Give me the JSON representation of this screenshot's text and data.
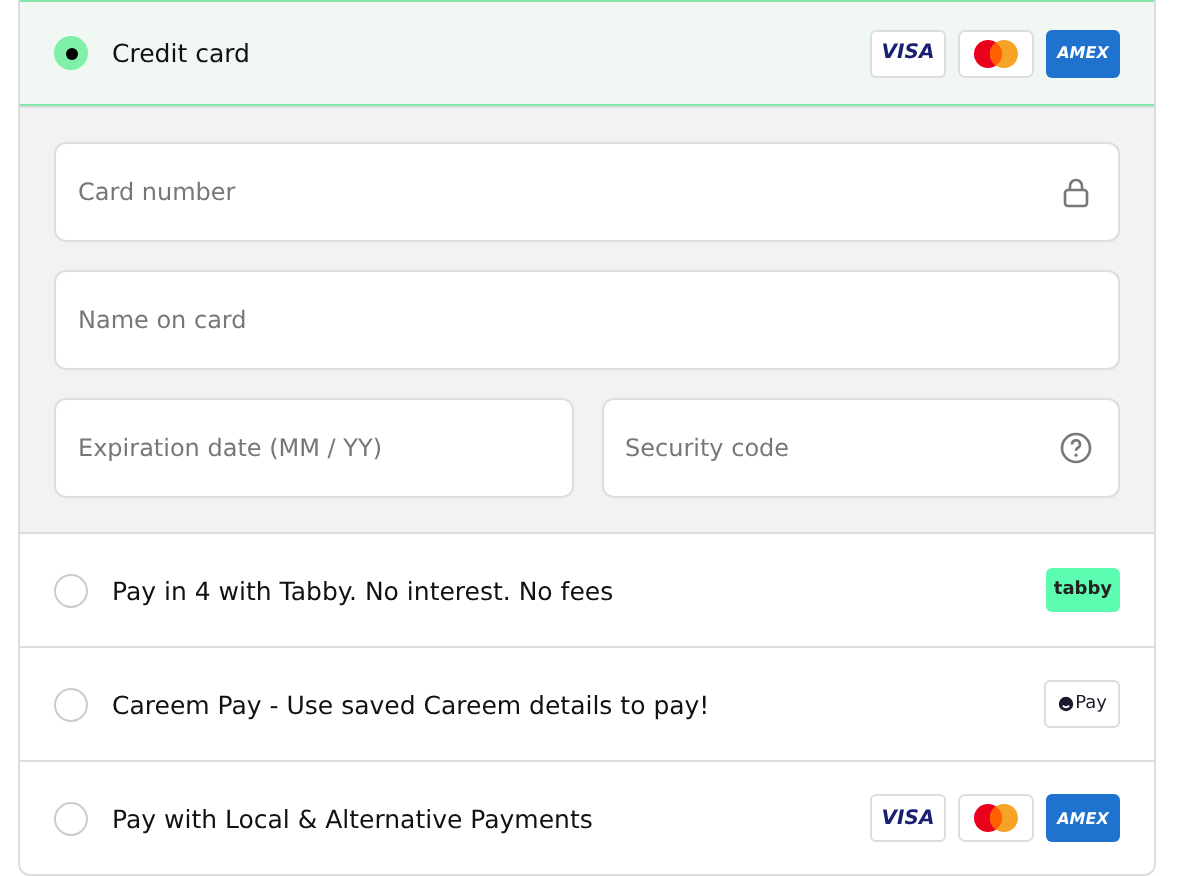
{
  "methods": [
    {
      "label": "Credit card",
      "selected": true,
      "logos": [
        {
          "kind": "visa",
          "text": "VISA"
        },
        {
          "kind": "mastercard"
        },
        {
          "kind": "amex",
          "text": "AMEX"
        }
      ],
      "fields": [
        {
          "kind": "card",
          "placeholder": "Card number"
        },
        {
          "kind": "name",
          "placeholder": "Name on card"
        },
        {
          "kind": "expiry",
          "placeholder": "Expiration date (MM / YY)"
        },
        {
          "kind": "cvc",
          "placeholder": "Security code"
        }
      ]
    },
    {
      "label": "Pay in 4 with Tabby. No interest. No fees",
      "selected": false,
      "logos": [
        {
          "kind": "tabby",
          "text": "tabby"
        }
      ]
    },
    {
      "label": "Careem Pay - Use saved Careem details to pay!",
      "selected": false,
      "logos": [
        {
          "kind": "careem",
          "text": "Pay"
        }
      ]
    },
    {
      "label": "Pay with Local & Alternative Payments",
      "selected": false,
      "logos": [
        {
          "kind": "visa",
          "text": "VISA"
        },
        {
          "kind": "mastercard"
        },
        {
          "kind": "amex",
          "text": "AMEX"
        }
      ]
    }
  ]
}
